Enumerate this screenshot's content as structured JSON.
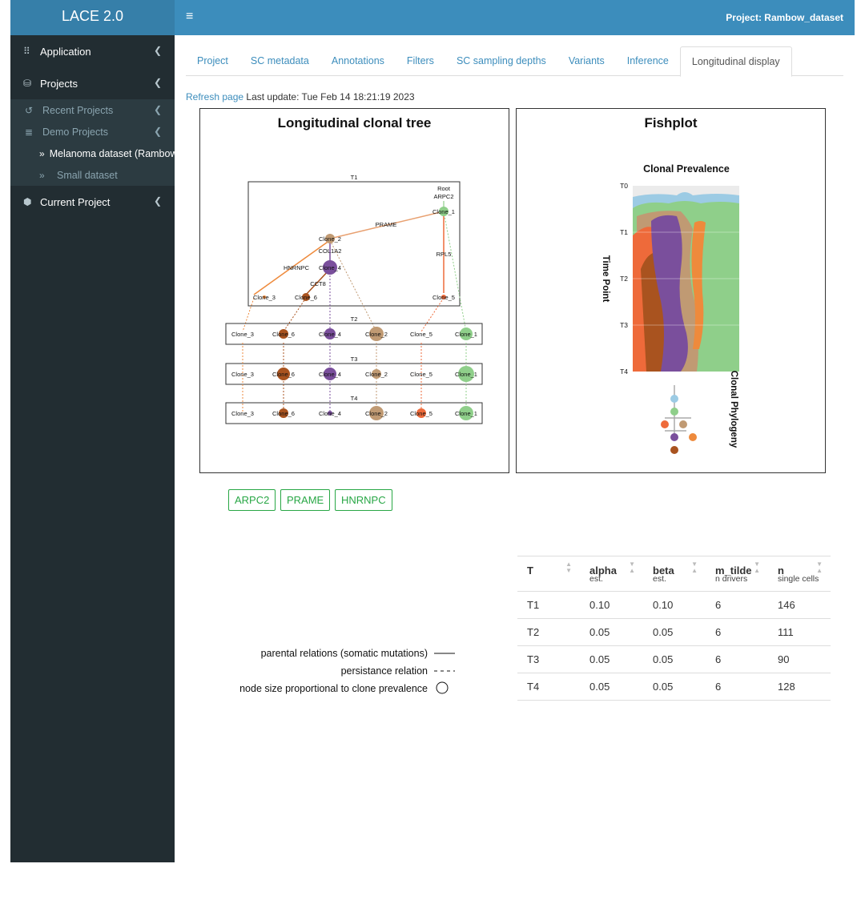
{
  "app": {
    "title": "LACE 2.0"
  },
  "header": {
    "project_title": "Project: Rambow_dataset",
    "menu_icon": "hamburger-icon"
  },
  "sidebar": {
    "application": "Application",
    "projects": "Projects",
    "recent_projects": "Recent Projects",
    "demo_projects": "Demo Projects",
    "melanoma": "Melanoma dataset (Rambow",
    "small": "Small dataset",
    "current_project": "Current Project"
  },
  "tabs": [
    "Project",
    "SC metadata",
    "Annotations",
    "Filters",
    "SC sampling depths",
    "Variants",
    "Inference",
    "Longitudinal display"
  ],
  "refresh": {
    "link": "Refresh page",
    "text": "Last update: Tue Feb 14 18:21:19 2023"
  },
  "tree_panel": {
    "title": "Longitudinal clonal tree",
    "time_labels": [
      "T1",
      "T2",
      "T3",
      "T4"
    ],
    "root_label": "Root",
    "edge_labels": [
      "ARPC2",
      "PRAME",
      "COL1A2",
      "RPL5",
      "HNRNPC",
      "CCT8"
    ],
    "clones": [
      "Clone_1",
      "Clone_2",
      "Clone_3",
      "Clone_4",
      "Clone_5",
      "Clone_6"
    ],
    "row_clones": [
      "Clone_3",
      "Clone_6",
      "Clone_4",
      "Clone_2",
      "Clone_5",
      "Clone_1"
    ]
  },
  "fish_panel": {
    "title": "Fishplot",
    "subtitle": "Clonal Prevalence",
    "y_label": "Time Point",
    "time_points": [
      "T0",
      "T1",
      "T2",
      "T3",
      "T4"
    ],
    "phylogeny_label": "Clonal Phylogeny"
  },
  "gene_buttons": [
    "ARPC2",
    "PRAME",
    "HNRNPC"
  ],
  "legend": {
    "parental": "parental relations (somatic mutations)",
    "persistence": "persistance relation",
    "node_size": "node size proportional to clone prevalence"
  },
  "table": {
    "headers": [
      {
        "name": "T",
        "sub": ""
      },
      {
        "name": "alpha",
        "sub": "est."
      },
      {
        "name": "beta",
        "sub": "est."
      },
      {
        "name": "m_tilde",
        "sub": "n drivers"
      },
      {
        "name": "n",
        "sub": "single cells"
      }
    ],
    "rows": [
      [
        "T1",
        "0.10",
        "0.10",
        "6",
        "146"
      ],
      [
        "T2",
        "0.05",
        "0.05",
        "6",
        "111"
      ],
      [
        "T3",
        "0.05",
        "0.05",
        "6",
        "90"
      ],
      [
        "T4",
        "0.05",
        "0.05",
        "6",
        "128"
      ]
    ]
  },
  "colors": {
    "clone_1": "#8fcf8a",
    "clone_2": "#c09a73",
    "clone_3": "#ee8a3c",
    "clone_4": "#7a4f9c",
    "clone_5": "#ee6a3a",
    "clone_6": "#a9531f",
    "root": "#9ccbe4",
    "header": "#3c8dbc",
    "sidebar": "#222d32"
  }
}
